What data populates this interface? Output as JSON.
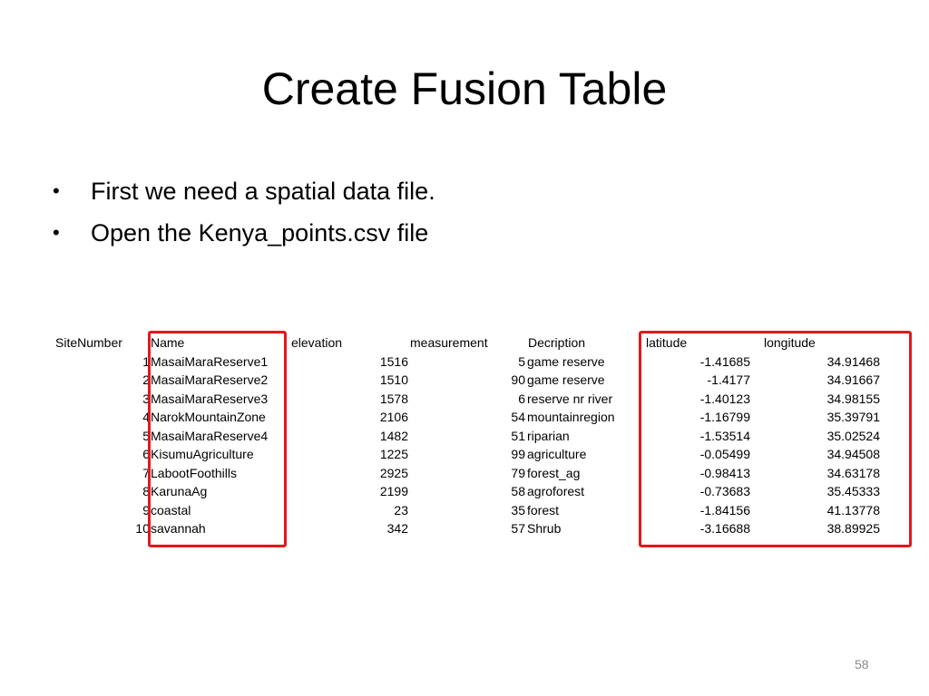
{
  "slide": {
    "title": "Create Fusion Table",
    "bullets": [
      "First we need a spatial data file.",
      "Open the Kenya_points.csv file"
    ],
    "slide_number": "58",
    "highlight_color": "#e8161c"
  },
  "table": {
    "headers": {
      "site": "SiteNumber",
      "name": "Name",
      "elevation": "elevation",
      "measurement": "measurement",
      "description": "Decription",
      "latitude": "latitude",
      "longitude": "longitude"
    },
    "rows": [
      {
        "site": "1",
        "name": "MasaiMaraReserve1",
        "elevation": "1516",
        "measurement": "5",
        "description": "game reserve",
        "latitude": "-1.41685",
        "longitude": "34.91468"
      },
      {
        "site": "2",
        "name": "MasaiMaraReserve2",
        "elevation": "1510",
        "measurement": "90",
        "description": "game reserve",
        "latitude": "-1.4177",
        "longitude": "34.91667"
      },
      {
        "site": "3",
        "name": "MasaiMaraReserve3",
        "elevation": "1578",
        "measurement": "6",
        "description": "reserve nr river",
        "latitude": "-1.40123",
        "longitude": "34.98155"
      },
      {
        "site": "4",
        "name": "NarokMountainZone",
        "elevation": "2106",
        "measurement": "54",
        "description": "mountainregion",
        "latitude": "-1.16799",
        "longitude": "35.39791"
      },
      {
        "site": "5",
        "name": "MasaiMaraReserve4",
        "elevation": "1482",
        "measurement": "51",
        "description": "riparian",
        "latitude": "-1.53514",
        "longitude": "35.02524"
      },
      {
        "site": "6",
        "name": "KisumuAgriculture",
        "elevation": "1225",
        "measurement": "99",
        "description": "agriculture",
        "latitude": "-0.05499",
        "longitude": "34.94508"
      },
      {
        "site": "7",
        "name": "LabootFoothills",
        "elevation": "2925",
        "measurement": "79",
        "description": "forest_ag",
        "latitude": "-0.98413",
        "longitude": "34.63178"
      },
      {
        "site": "8",
        "name": "KarunaAg",
        "elevation": "2199",
        "measurement": "58",
        "description": "agroforest",
        "latitude": "-0.73683",
        "longitude": "35.45333"
      },
      {
        "site": "9",
        "name": "coastal",
        "elevation": "23",
        "measurement": "35",
        "description": "forest",
        "latitude": "-1.84156",
        "longitude": "41.13778"
      },
      {
        "site": "10",
        "name": "savannah",
        "elevation": "342",
        "measurement": "57",
        "description": "Shrub",
        "latitude": "-3.16688",
        "longitude": "38.89925"
      }
    ]
  }
}
